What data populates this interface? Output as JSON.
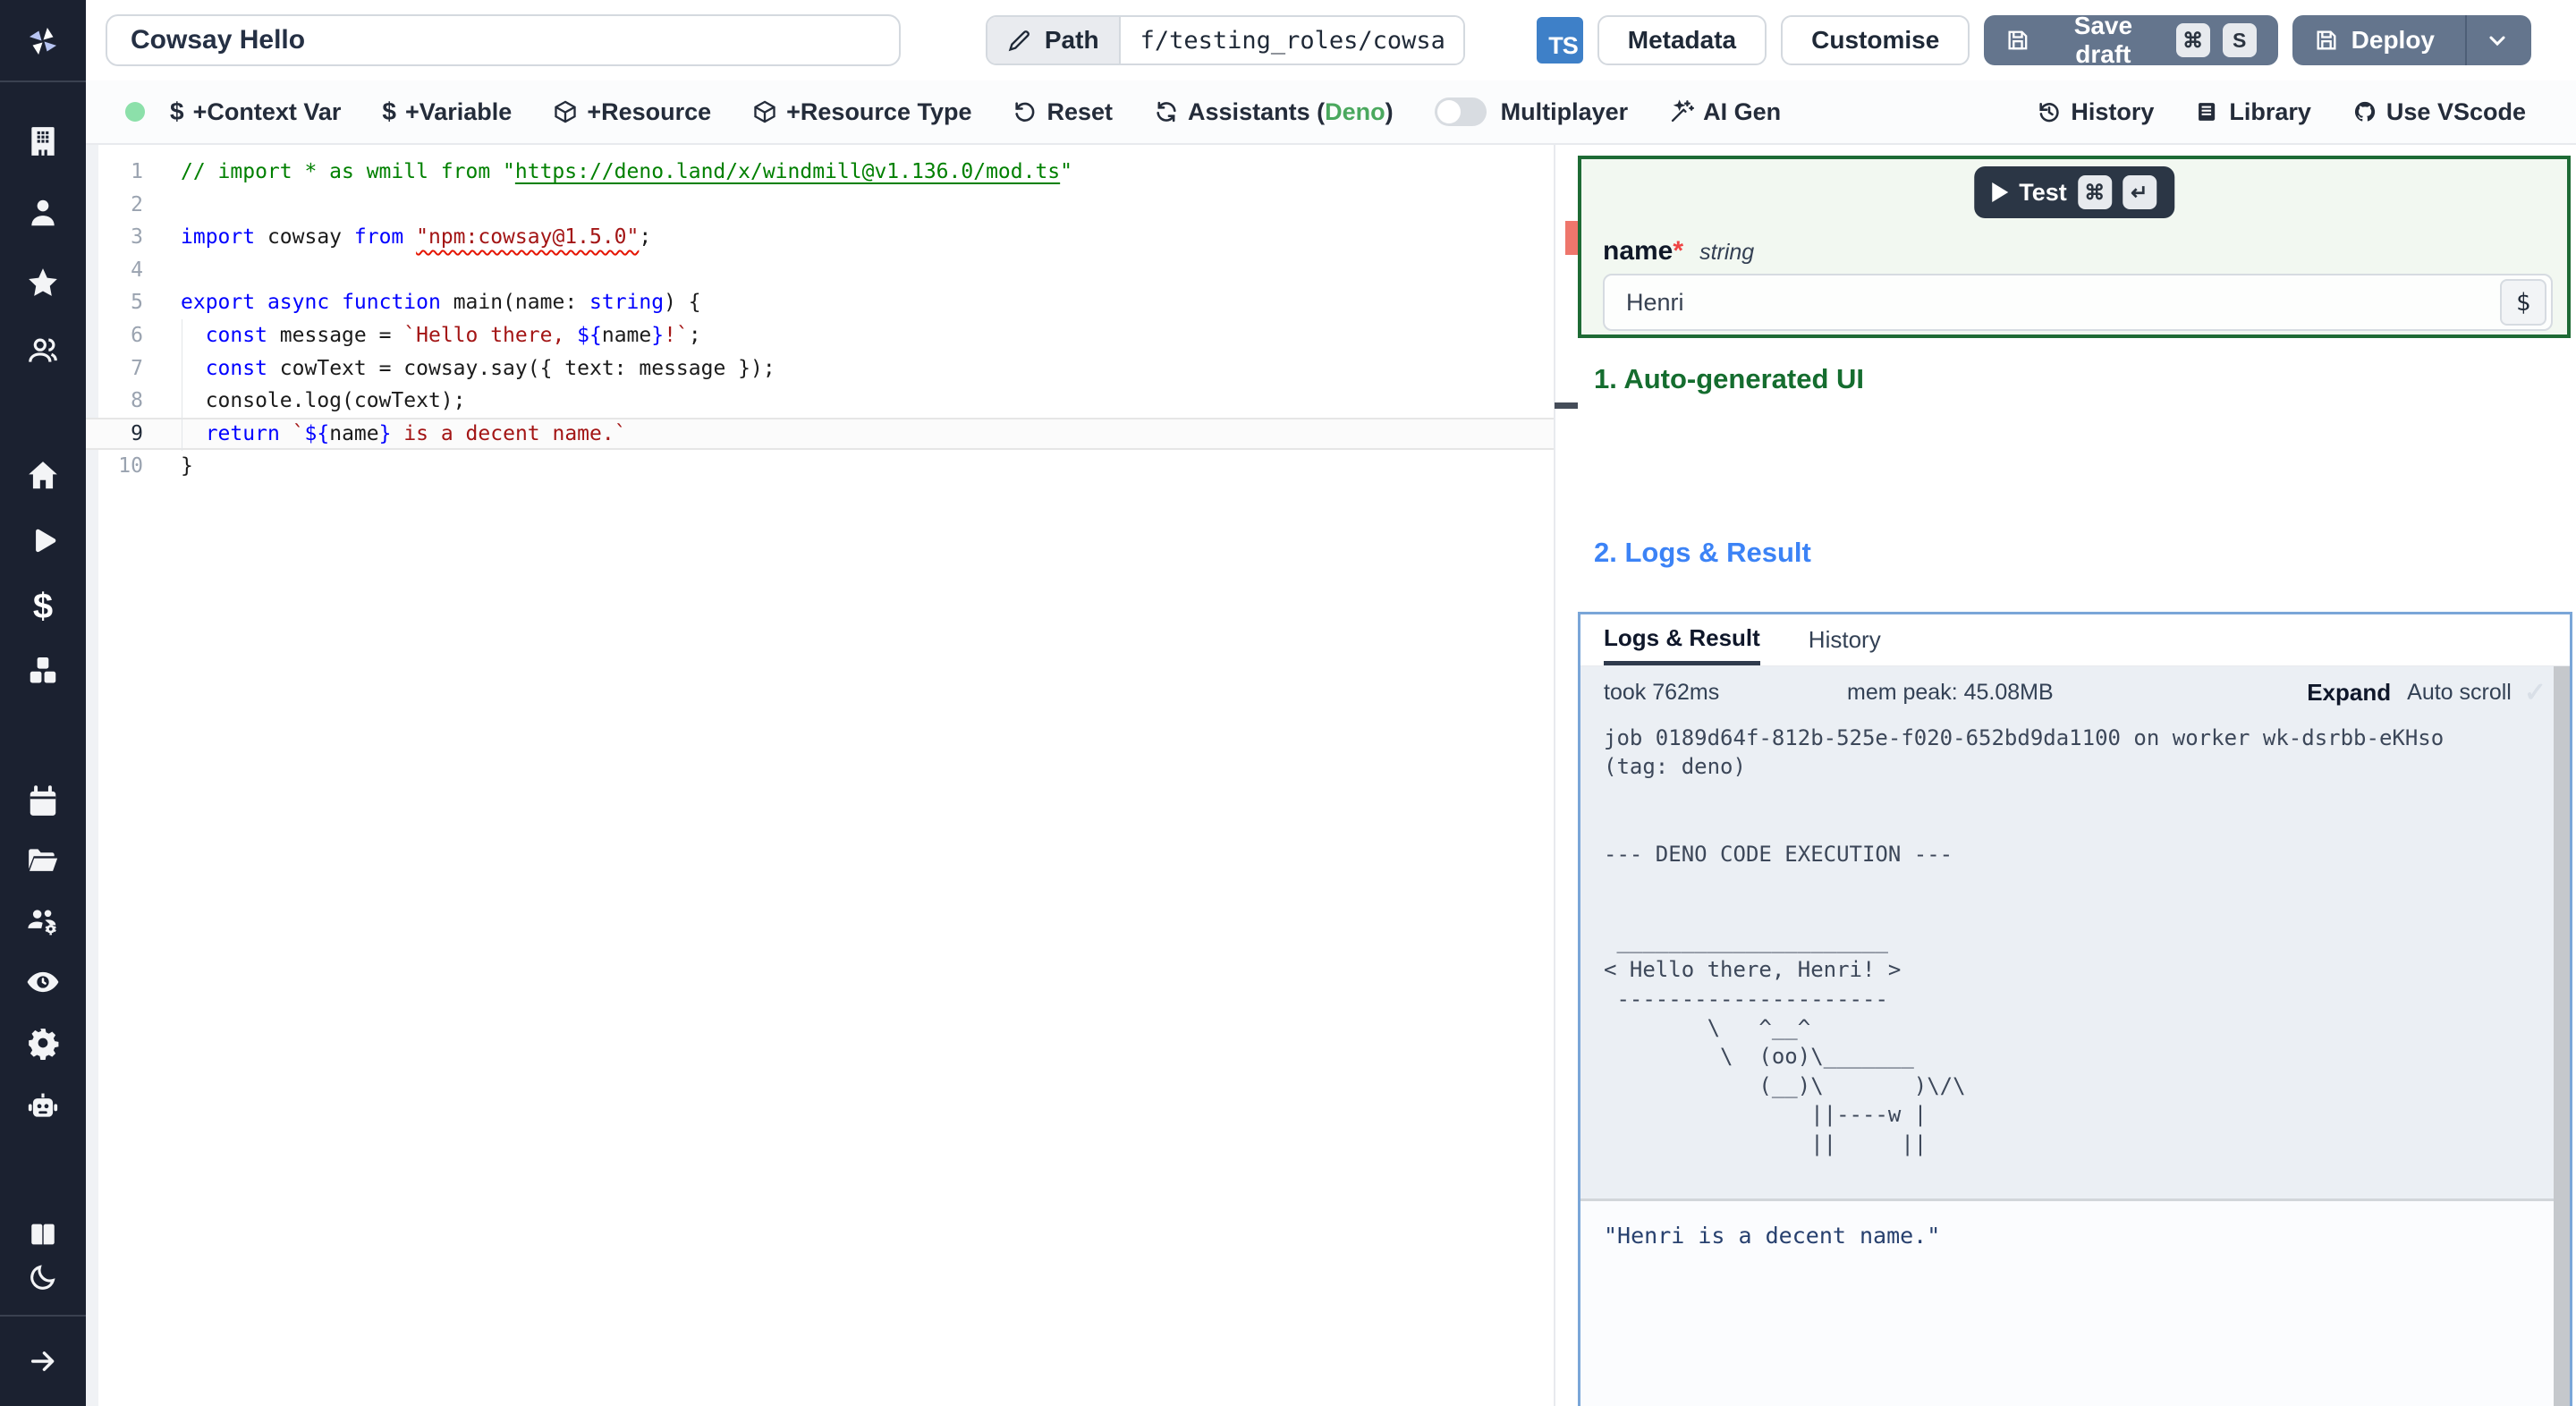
{
  "topbar": {
    "title_value": "Cowsay Hello",
    "path_label": "Path",
    "path_value": "f/testing_roles/cowsa",
    "ts_badge": "TS",
    "metadata_label": "Metadata",
    "customise_label": "Customise",
    "save_draft_label": "Save draft",
    "save_kbd": [
      "⌘",
      "S"
    ],
    "deploy_label": "Deploy"
  },
  "toolbar": {
    "context_var": "+Context Var",
    "variable": "+Variable",
    "resource": "+Resource",
    "resource_type": "+Resource Type",
    "reset": "Reset",
    "assistants_pre": "Assistants (",
    "assistants_lang": "Deno",
    "assistants_post": ")",
    "multiplayer": "Multiplayer",
    "ai_gen": "AI Gen",
    "history": "History",
    "library": "Library",
    "use_vscode": "Use VScode"
  },
  "sidebar": {
    "icons": [
      "windmill-logo",
      "building",
      "user",
      "star",
      "users",
      "home",
      "play",
      "dollar",
      "cubes",
      "calendar",
      "folder",
      "user-group-gear",
      "eye",
      "gear",
      "robot",
      "book",
      "moon",
      "arrow-right"
    ]
  },
  "editor": {
    "current_line": 9,
    "lines": [
      {
        "n": 1,
        "tokens": [
          [
            "cm",
            "// import * as wmill from \""
          ],
          [
            "lnk",
            "https://deno.land/x/windmill@v1.136.0/mod.ts"
          ],
          [
            "cm",
            "\""
          ]
        ]
      },
      {
        "n": 2,
        "tokens": []
      },
      {
        "n": 3,
        "tokens": [
          [
            "kw",
            "import"
          ],
          [
            "pn",
            " cowsay "
          ],
          [
            "kw",
            "from"
          ],
          [
            "pn",
            " "
          ],
          [
            "sqg",
            "\"npm:cowsay@1.5.0\""
          ],
          [
            "pn",
            ";"
          ]
        ]
      },
      {
        "n": 4,
        "tokens": []
      },
      {
        "n": 5,
        "tokens": [
          [
            "kw",
            "export"
          ],
          [
            "pn",
            " "
          ],
          [
            "kw",
            "async"
          ],
          [
            "pn",
            " "
          ],
          [
            "kw",
            "function"
          ],
          [
            "pn",
            " main(name: "
          ],
          [
            "ty",
            "string"
          ],
          [
            "pn",
            ") {"
          ]
        ]
      },
      {
        "n": 6,
        "tokens": [
          [
            "pn",
            "  "
          ],
          [
            "kw",
            "const"
          ],
          [
            "pn",
            " message = "
          ],
          [
            "str",
            "`Hello there, "
          ],
          [
            "dl",
            "${"
          ],
          [
            "pn",
            "name"
          ],
          [
            "dl",
            "}"
          ],
          [
            "str",
            "!`"
          ],
          [
            "pn",
            ";"
          ]
        ]
      },
      {
        "n": 7,
        "tokens": [
          [
            "pn",
            "  "
          ],
          [
            "kw",
            "const"
          ],
          [
            "pn",
            " cowText = cowsay.say({ text: message });"
          ]
        ]
      },
      {
        "n": 8,
        "tokens": [
          [
            "pn",
            "  console.log(cowText);"
          ]
        ]
      },
      {
        "n": 9,
        "tokens": [
          [
            "pn",
            "  "
          ],
          [
            "kw",
            "return"
          ],
          [
            "pn",
            " "
          ],
          [
            "str",
            "`"
          ],
          [
            "dl",
            "${"
          ],
          [
            "pn",
            "name"
          ],
          [
            "dl",
            "}"
          ],
          [
            "str",
            " is a decent name.`"
          ]
        ]
      },
      {
        "n": 10,
        "tokens": [
          [
            "pn",
            "}"
          ]
        ]
      }
    ]
  },
  "runpanel": {
    "test_label": "Test",
    "test_kbd": [
      "⌘",
      "↵"
    ],
    "field_name": "name",
    "field_required": "*",
    "field_type": "string",
    "field_value": "Henri",
    "var_picker": "$"
  },
  "sections": {
    "auto_ui": "1. Auto-generated UI",
    "logs_result": "2. Logs & Result"
  },
  "logs": {
    "tabs": [
      "Logs & Result",
      "History"
    ],
    "took": "took 762ms",
    "mem": "mem peak: 45.08MB",
    "expand": "Expand",
    "autoscroll": "Auto scroll",
    "check": "✓",
    "log_text": "job 0189d64f-812b-525e-f020-652bd9da1100 on worker wk-dsrbb-eKHso (tag: deno)\n\n\n--- DENO CODE EXECUTION ---\n\n\n _____________________\n< Hello there, Henri! >\n ---------------------\n        \\   ^__^\n         \\  (oo)\\_______\n            (__)\\       )\\/\\\n                ||----w |\n                ||     ||",
    "result": "\"Henri is a decent name.\""
  }
}
